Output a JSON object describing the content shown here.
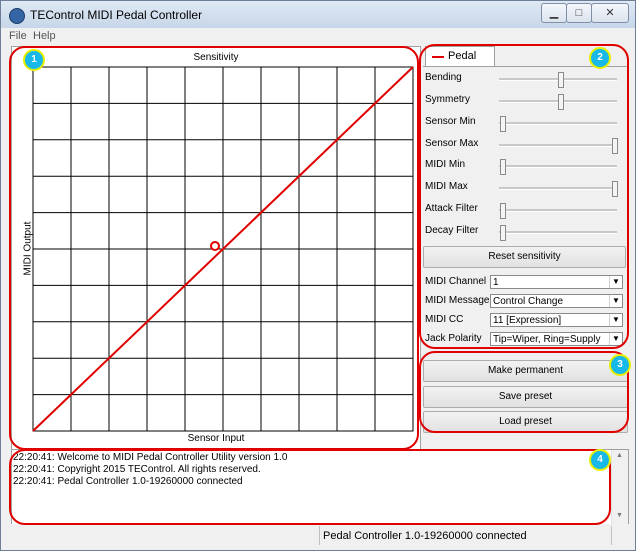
{
  "window": {
    "title": "TEControl MIDI Pedal Controller"
  },
  "menu": {
    "items": [
      "File",
      "Help"
    ]
  },
  "graph": {
    "title": "Sensitivity",
    "xlabel": "Sensor Input",
    "ylabel": "MIDI Output"
  },
  "tab": {
    "label": "Pedal"
  },
  "sliders": [
    {
      "label": "Bending",
      "value": 0.52
    },
    {
      "label": "Symmetry",
      "value": 0.52
    },
    {
      "label": "Sensor Min",
      "value": 0.0
    },
    {
      "label": "Sensor Max",
      "value": 1.0
    },
    {
      "label": "MIDI Min",
      "value": 0.0
    },
    {
      "label": "MIDI Max",
      "value": 1.0
    },
    {
      "label": "Attack Filter",
      "value": 0.0
    },
    {
      "label": "Decay Filter",
      "value": 0.0
    }
  ],
  "reset_button": "Reset sensitivity",
  "fields": [
    {
      "label": "MIDI Channel",
      "value": "1"
    },
    {
      "label": "MIDI Message",
      "value": "Control Change"
    },
    {
      "label": "MIDI CC",
      "value": "11  [Expression]"
    },
    {
      "label": "Jack Polarity",
      "value": "Tip=Wiper, Ring=Supply"
    }
  ],
  "buttons": {
    "make_permanent": "Make permanent",
    "save_preset": "Save preset",
    "load_preset": "Load preset"
  },
  "log": [
    "22:20:41: Welcome to MIDI Pedal Controller Utility version 1.0",
    "22:20:41: Copyright 2015 TEControl. All rights reserved.",
    "22:20:41: Pedal Controller 1.0-19260000 connected"
  ],
  "status": {
    "text": "Pedal Controller 1.0-19260000 connected"
  },
  "annotations": [
    "1",
    "2",
    "3",
    "4"
  ],
  "colors": {
    "accent": "#e00000",
    "badge": "#18b8e8"
  }
}
